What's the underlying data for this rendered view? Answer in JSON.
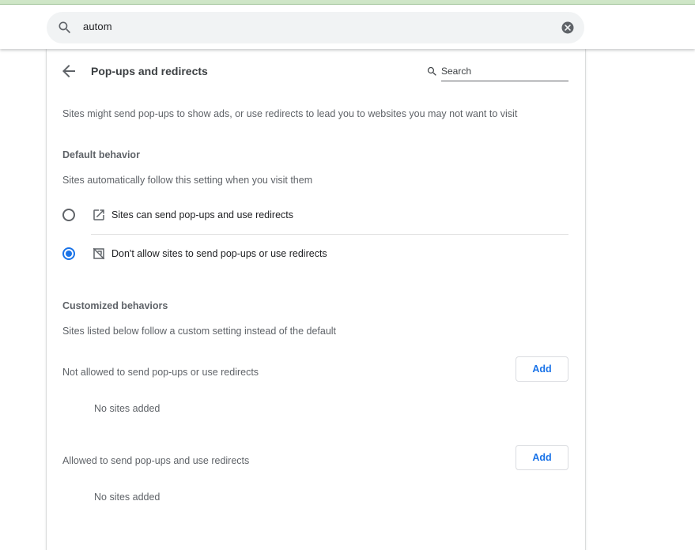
{
  "search": {
    "query": "autom"
  },
  "page": {
    "title": "Pop-ups and redirects",
    "search_placeholder": "Search",
    "description": "Sites might send pop-ups to show ads, or use redirects to lead you to websites you may not want to visit"
  },
  "default_behavior": {
    "heading": "Default behavior",
    "subtitle": "Sites automatically follow this setting when you visit them",
    "options": [
      {
        "label": "Sites can send pop-ups and use redirects",
        "icon": "open-in-new-icon",
        "selected": false
      },
      {
        "label": "Don't allow sites to send pop-ups or use redirects",
        "icon": "blocked-popup-icon",
        "selected": true
      }
    ]
  },
  "customized_behaviors": {
    "heading": "Customized behaviors",
    "subtitle": "Sites listed below follow a custom setting instead of the default",
    "sections": [
      {
        "label": "Not allowed to send pop-ups or use redirects",
        "add_label": "Add",
        "empty_text": "No sites added"
      },
      {
        "label": "Allowed to send pop-ups and use redirects",
        "add_label": "Add",
        "empty_text": "No sites added"
      }
    ]
  },
  "colors": {
    "accent": "#1a73e8",
    "text": "#202124",
    "secondary_text": "#5f6368"
  }
}
